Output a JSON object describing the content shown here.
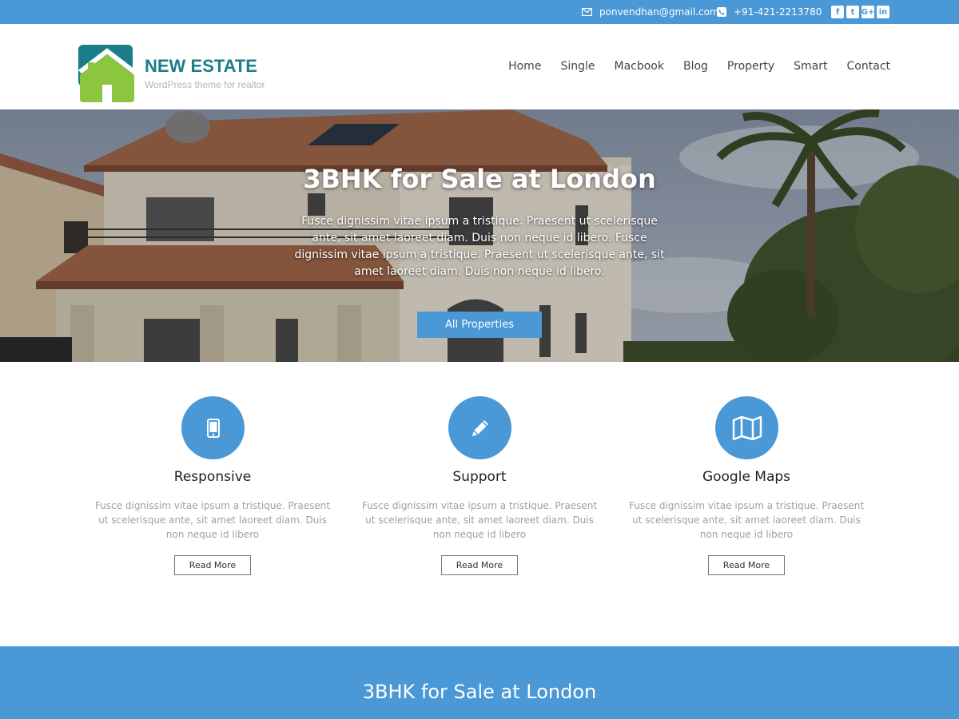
{
  "topbar": {
    "email": "ponvendhan@gmail.com",
    "phone": "+91-421-2213780",
    "social": [
      {
        "icon": "facebook-icon",
        "glyph": "f"
      },
      {
        "icon": "twitter-icon",
        "glyph": "t"
      },
      {
        "icon": "google-plus-icon",
        "glyph": "G+"
      },
      {
        "icon": "linkedin-icon",
        "glyph": "in"
      }
    ]
  },
  "header": {
    "brand_name": "NEW ESTATE",
    "tagline": "WordPress theme for realtor",
    "nav": [
      "Home",
      "Single",
      "Macbook",
      "Blog",
      "Property",
      "Smart",
      "Contact"
    ]
  },
  "hero": {
    "title": "3BHK for Sale at London",
    "text": "Fusce dignissim vitae ipsum a tristique. Praesent ut scelerisque ante, sit amet laoreet diam. Duis non neque id libero. Fusce dignissim vitae ipsum a tristique. Praesent ut scelerisque ante, sit amet laoreet diam. Duis non neque id libero.",
    "button": "All Properties"
  },
  "features": [
    {
      "icon": "mobile-phone-icon",
      "title": "Responsive",
      "text": "Fusce dignissim vitae ipsum a tristique. Praesent ut scelerisque ante, sit amet laoreet diam. Duis non neque id libero",
      "button": "Read More"
    },
    {
      "icon": "pencil-icon",
      "title": "Support",
      "text": "Fusce dignissim vitae ipsum a tristique. Praesent ut scelerisque ante, sit amet laoreet diam. Duis non neque id libero",
      "button": "Read More"
    },
    {
      "icon": "map-icon",
      "title": "Google Maps",
      "text": "Fusce dignissim vitae ipsum a tristique. Praesent ut scelerisque ante, sit amet laoreet diam. Duis non neque id libero",
      "button": "Read More"
    }
  ],
  "band": {
    "title": "3BHK for Sale at London"
  },
  "colors": {
    "accent": "#4a98d6",
    "brand": "#1c7d8a",
    "logo_green": "#8cc63f"
  }
}
